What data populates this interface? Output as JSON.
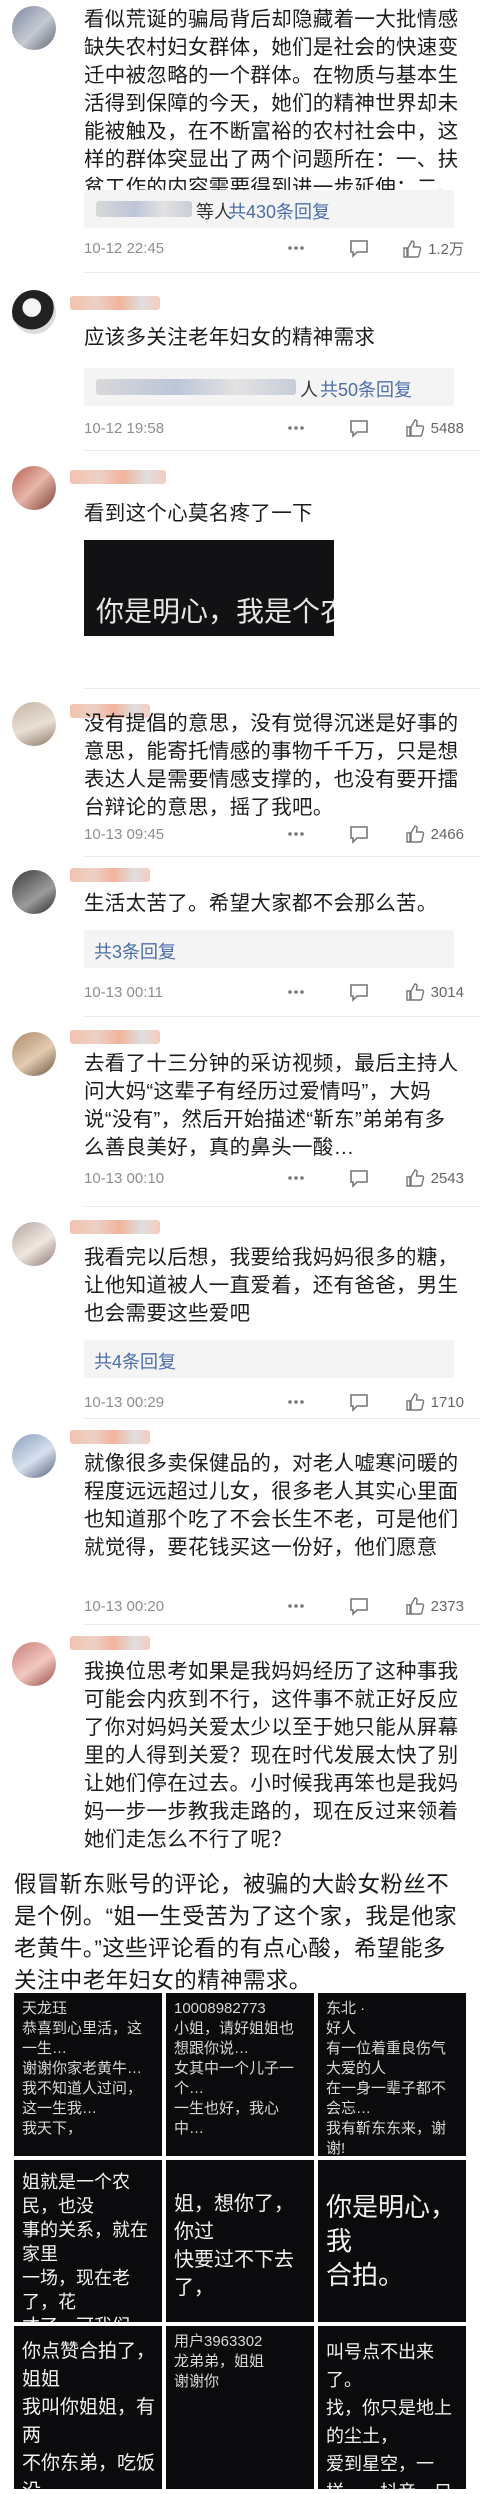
{
  "comments": [
    {
      "text": "看似荒诞的骗局背后却隐藏着一大批情感缺失农村妇女群体，她们是社会的快速变迁中被忽略的一个群体。在物质与基本生活得到保障的今天，她们的精神世界却未能被触及，在不断富裕的农村社会中，这样的群体突显出了两个问题所在：一、扶贫工作的内容需要得到进一步延伸；二、农村发展需要引入女性视角",
      "reply_suffix": "等人",
      "reply_link": "共430条回复",
      "date": "10-12 22:45",
      "likes": "1.2万"
    },
    {
      "text": "应该多关注老年妇女的精神需求",
      "reply_suffix": "人",
      "reply_link": "共50条回复",
      "date": "10-12 19:58",
      "likes": "5488"
    },
    {
      "text": "看到这个心莫名疼了一下",
      "video_text": "你是明心，我是个农"
    },
    {
      "text": "没有提倡的意思，没有觉得沉迷是好事的意思，能寄托情感的事物千千万，只是想表达人是需要情感支撑的，也没有要开擂台辩论的意思，摇了我吧。",
      "date": "10-13 09:45",
      "likes": "2466"
    },
    {
      "text": "生活太苦了。希望大家都不会那么苦。",
      "reply_link": "共3条回复",
      "date": "10-13 00:11",
      "likes": "3014"
    },
    {
      "text": "去看了十三分钟的采访视频，最后主持人问大妈“这辈子有经历过爱情吗”，大妈说“没有”，然后开始描述“靳东”弟弟有多么善良美好，真的鼻头一酸…",
      "date": "10-13 00:10",
      "likes": "2543"
    },
    {
      "text": "我看完以后想，我要给我妈妈很多的糖，让他知道被人一直爱着，还有爸爸，男生也会需要这些爱吧",
      "reply_link": "共4条回复",
      "date": "10-13 00:29",
      "likes": "1710"
    },
    {
      "text": "就像很多卖保健品的，对老人嘘寒问暖的程度远远超过儿女，很多老人其实心里面也知道那个吃了不会长生不老，可是他们就觉得，要花钱买这一份好，他们愿意",
      "date": "10-13 00:20",
      "likes": "2373"
    },
    {
      "text": "我换位思考如果是我妈妈经历了这种事我可能会内疚到不行，这件事不就正好反应了你对妈妈关爱太少以至于她只能从屏幕里的人得到关爱？现在时代发展太快了别让她们停在过去。小时候我再笨也是我妈妈一步一步教我走路的，现在反过来领着她们走怎么不行了呢？"
    }
  ],
  "bottom": {
    "text": "假冒靳东账号的评论，被骗的大龄女粉丝不是个例。“姐一生受苦为了这个家，我是他家老黄牛。”这些评论看的有点心酸，希望能多关注中老年妇女的精神需求。",
    "cells": [
      {
        "text": "天龙珏\n恭喜到心里活，这一生…\n谢谢你家老黄牛…\n我不知道人过问，这一生我…\n我天下，"
      },
      {
        "text": "10008982773\n小姐，请好姐姐也想跟你说…\n女其中一个儿子一个…\n一生也好，我心中…"
      },
      {
        "text": "东北 ·\n好人\n有一位着重良伤气大爱的人\n在一身一辈子都不会忘…\n我有靳东东来，谢谢!"
      },
      {
        "text": "姐就是一个农民，也没\n事的关系，就在家里\n一场，现在老了，花\n才了，可我们了…",
        "big": ""
      },
      {
        "text": "姐，想你了，你过\n快要过不下去了，",
        "big": ""
      },
      {
        "text": "你是明心，我\n合拍。",
        "big": ""
      },
      {
        "text": "你点赞合拍了，姐姐\n我叫你姐姐，有两\n不你东弟，吃饭没"
      },
      {
        "text": "用户3963302\n龙弟弟，姐姐\n谢谢你",
        "big": ""
      },
      {
        "text": "叫号点不出来了。\n找，你只是地上的尘土，\n爱到星空，一样，一抖音，只是好发起"
      }
    ]
  },
  "icons": {
    "like": "thumbs-up-icon",
    "more": "more-options-icon",
    "reply": "comment-reply-icon"
  }
}
